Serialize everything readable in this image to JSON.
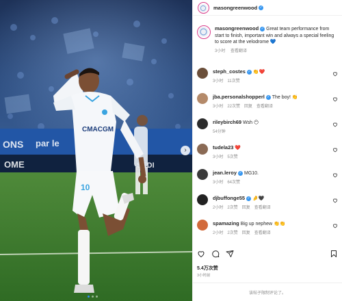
{
  "post": {
    "author": "masongreenwood",
    "verified_label": "✓",
    "caption": "Great team performance from start to finish, important win and always a special feeling to score at the velodrome 💙",
    "caption_time": "3小时",
    "caption_translate": "查看翻译",
    "jersey_sponsor": "CMACGM",
    "jersey_number": "10"
  },
  "comments": [
    {
      "user": "steph_costes",
      "text": "👏❤️",
      "time": "3小时",
      "likes": "11次赞",
      "reply": "",
      "translate": "",
      "verified": true,
      "avatar_color": "#6b4f3a"
    },
    {
      "user": "jba.personalshopperl",
      "text": "The boy! 👏",
      "time": "3小时",
      "likes": "22次赞",
      "reply": "回复",
      "translate": "查看翻译",
      "verified": true,
      "avatar_color": "#b48a6a"
    },
    {
      "user": "rileybirch69",
      "text": "Wsh 😶",
      "time": "54分钟",
      "likes": "",
      "reply": "",
      "translate": "",
      "verified": false,
      "avatar_color": "#2b2b2b"
    },
    {
      "user": "tudela23",
      "text": "❤️",
      "time": "3小时",
      "likes": "5次赞",
      "reply": "",
      "translate": "",
      "verified": false,
      "avatar_color": "#8a6a55"
    },
    {
      "user": "jean.leroy",
      "text": "MG10.",
      "time": "3小时",
      "likes": "64次赞",
      "reply": "",
      "translate": "",
      "verified": true,
      "avatar_color": "#3a3a3a"
    },
    {
      "user": "djbuffonge55",
      "text": "🤌🖤",
      "time": "2小时",
      "likes": "2次赞",
      "reply": "回复",
      "translate": "查看翻译",
      "verified": true,
      "avatar_color": "#222222"
    },
    {
      "user": "spamazing",
      "text": "Big up nephew 👏👏",
      "time": "2小时",
      "likes": "2次赞",
      "reply": "回复",
      "translate": "查看翻译",
      "verified": false,
      "avatar_color": "#d26a3b"
    }
  ],
  "actions": {
    "like": "heart-icon",
    "comment": "comment-icon",
    "share": "share-icon",
    "save": "bookmark-icon"
  },
  "stats": {
    "likes": "5.4万次赞",
    "posted": "3小时前"
  },
  "footer": {
    "notice": "该帖子限制评论了。"
  },
  "colors": {
    "verified": "#3897f0",
    "ring": "#d93a8a",
    "carousel_active": "#2f8cff"
  }
}
